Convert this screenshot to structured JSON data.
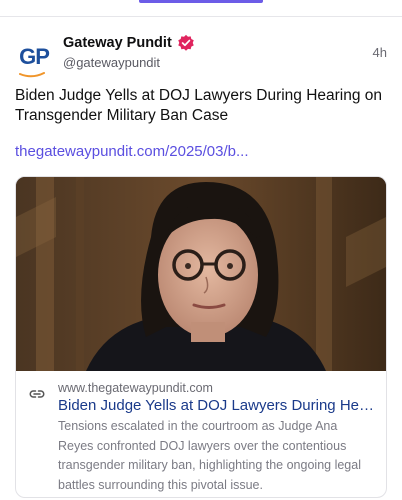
{
  "author": {
    "name": "Gateway Pundit",
    "handle": "@gatewaypundit",
    "avatar_text": "GP",
    "verified_color": "#e0245e"
  },
  "post": {
    "timestamp": "4h",
    "text": "Biden Judge Yells at DOJ Lawyers During Hearing on Transgender Military Ban Case",
    "link": "thegatewaypundit.com/2025/03/b..."
  },
  "link_card": {
    "domain": "www.thegatewaypundit.com",
    "title": "Biden Judge Yells at DOJ Lawyers During Hear...",
    "description": "Tensions escalated in the courtroom as Judge Ana Reyes confronted DOJ lawyers over the contentious transgender military ban, highlighting the ongoing legal battles surrounding this pivotal issue."
  },
  "colors": {
    "accent": "#6c5ce7",
    "link": "#5b4fe0",
    "card_title": "#1a3a8a",
    "brand_blue": "#1d4f9c",
    "brand_orange": "#f0952a"
  }
}
